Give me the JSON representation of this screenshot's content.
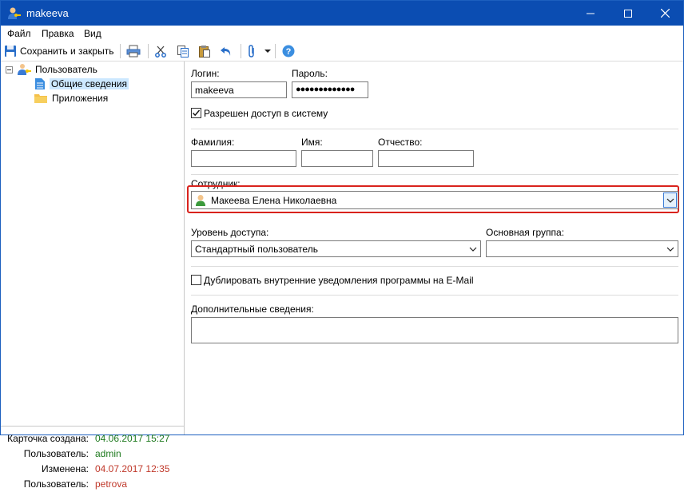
{
  "window": {
    "title": "makeeva",
    "icon": "user-key-icon"
  },
  "menu": [
    {
      "label": "Файл"
    },
    {
      "label": "Правка"
    },
    {
      "label": "Вид"
    }
  ],
  "toolbar": {
    "save_close_label": "Сохранить и закрыть"
  },
  "tree": {
    "root": "Пользователь",
    "children": [
      {
        "label": "Общие сведения"
      },
      {
        "label": "Приложения"
      }
    ]
  },
  "info": {
    "created_label": "Карточка создана:",
    "created_value": "04.06.2017  15:27",
    "created_user_label": "Пользователь:",
    "created_user_value": "admin",
    "changed_label": "Изменена:",
    "changed_value": "04.07.2017  12:35",
    "changed_user_label": "Пользователь:",
    "changed_user_value": "petrova"
  },
  "form": {
    "login_label": "Логин:",
    "login_value": "makeeva",
    "password_label": "Пароль:",
    "password_value": "●●●●●●●●●●●●●",
    "access_checkbox_label": "Разрешен доступ в систему",
    "access_checked": true,
    "lastname_label": "Фамилия:",
    "firstname_label": "Имя:",
    "patronymic_label": "Отчество:",
    "employee_label": "Сотрудник:",
    "employee_value": "Макеева Елена Николаевна",
    "access_level_label": "Уровень доступа:",
    "access_level_value": "Стандартный пользователь",
    "main_group_label": "Основная группа:",
    "main_group_value": "",
    "duplicate_label": "Дублировать внутренние уведомления программы на E-Mail",
    "duplicate_checked": false,
    "additional_label": "Дополнительные сведения:"
  },
  "colors": {
    "titlebar": "#0b4db2",
    "highlight": "#d9231d",
    "green": "#1f7a1f",
    "red": "#c0392b",
    "selection": "#cce8ff"
  }
}
